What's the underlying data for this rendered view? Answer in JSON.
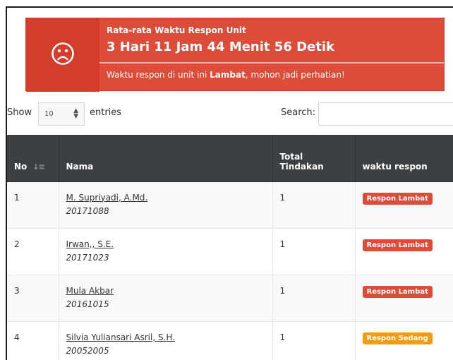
{
  "alert": {
    "icon": "sad-face-icon",
    "subtitle": "Rata-rata Waktu Respon Unit",
    "title": "3 Hari 11 Jam 44 Menit 56 Detik",
    "message_pre": "Waktu respon di unit ini ",
    "message_bold": "Lambat",
    "message_post": ", mohon jadi perhatian!",
    "color": "#dd4b39"
  },
  "controls": {
    "show_label": "Show",
    "length_value": "10",
    "entries_label": "entries",
    "search_label": "Search:",
    "search_value": ""
  },
  "table": {
    "headers": {
      "no": "No",
      "nama": "Nama",
      "total_line1": "Total",
      "total_line2": "Tindakan",
      "waktu": "waktu respon"
    },
    "rows": [
      {
        "no": "1",
        "name": "M. Supriyadi, A.Md.",
        "nip": "20171088",
        "total": "1",
        "status": "Respon Lambat",
        "status_color": "#dd4b39"
      },
      {
        "no": "2",
        "name": "Irwan,, S.E.",
        "nip": "20171023",
        "total": "1",
        "status": "Respon Lambat",
        "status_color": "#dd4b39"
      },
      {
        "no": "3",
        "name": "Mula Akbar",
        "nip": "20161015",
        "total": "1",
        "status": "Respon Lambat",
        "status_color": "#dd4b39"
      },
      {
        "no": "4",
        "name": "Silvia Yuliansari Asril, S.H.",
        "nip": "20052005",
        "total": "1",
        "status": "Respon Sedang",
        "status_color": "#f39c12"
      }
    ]
  }
}
